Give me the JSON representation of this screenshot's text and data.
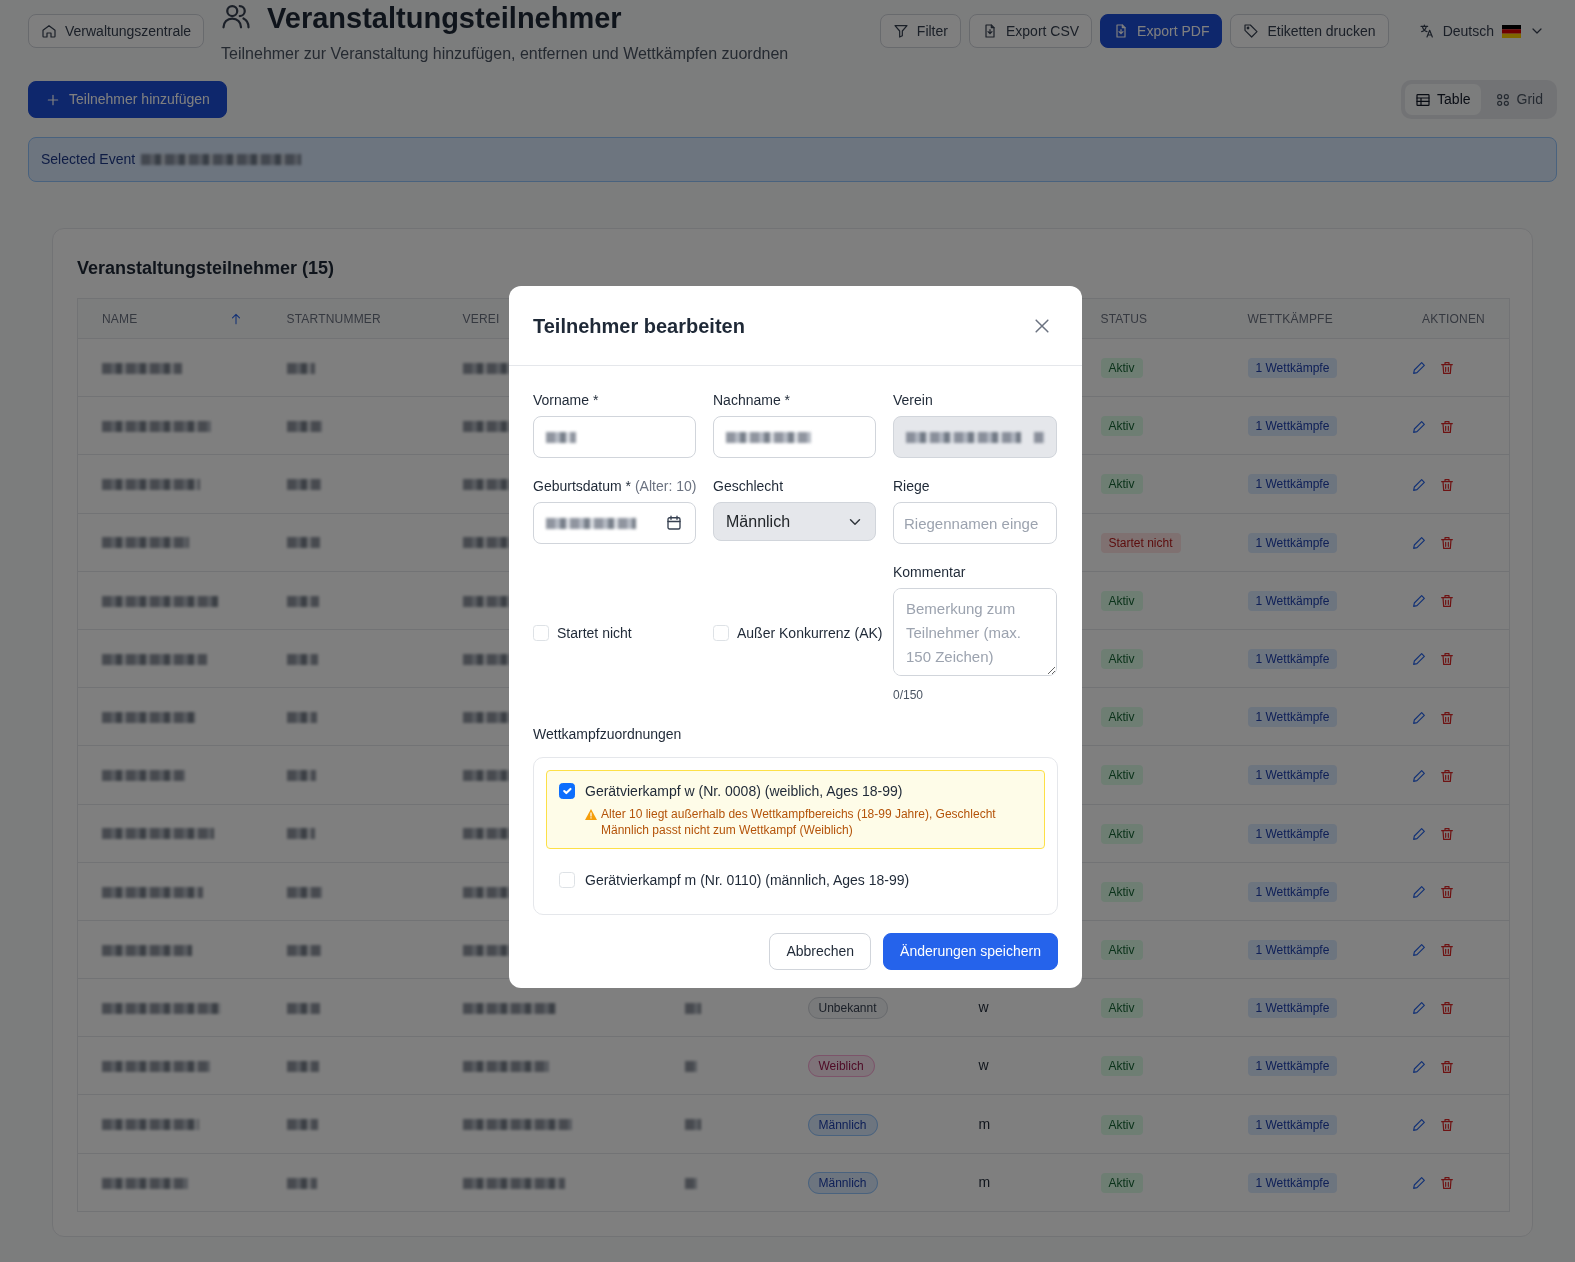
{
  "header": {
    "home_button": "Verwaltungszentrale",
    "title": "Veranstaltungsteilnehmer",
    "subtitle": "Teilnehmer zur Veranstaltung hinzufügen, entfernen und Wettkämpfen zuordnen",
    "actions": [
      {
        "label": "Filter",
        "kind": "filter",
        "primary": false
      },
      {
        "label": "Export CSV",
        "kind": "export",
        "primary": false
      },
      {
        "label": "Export PDF",
        "kind": "export",
        "primary": true
      },
      {
        "label": "Etiketten drucken",
        "kind": "labels",
        "primary": false
      }
    ],
    "language": "Deutsch"
  },
  "add_button": "Teilnehmer hinzufügen",
  "view_toggle": [
    {
      "label": "Table",
      "kind": "table",
      "selected": true
    },
    {
      "label": "Grid",
      "kind": "grid",
      "selected": false
    }
  ],
  "selected_event": {
    "label": "Selected Event"
  },
  "table": {
    "title": "Veranstaltungsteilnehmer (15)",
    "columns": [
      {
        "label": "NAME",
        "sorted": true
      },
      {
        "label": "STARTNUMMER",
        "sorted": false
      },
      {
        "label": "VEREI",
        "sorted": false
      },
      {
        "label": "STATUS",
        "sorted": false
      },
      {
        "label": "WETTKÄMPFE",
        "sorted": false
      },
      {
        "label": "AKTIONEN",
        "sorted": false
      }
    ],
    "rows": [
      {
        "status": {
          "label": "Aktiv",
          "kind": "active"
        },
        "competitions": "1 Wettkämpfe"
      },
      {
        "status": {
          "label": "Aktiv",
          "kind": "active"
        },
        "competitions": "1 Wettkämpfe"
      },
      {
        "status": {
          "label": "Aktiv",
          "kind": "active"
        },
        "competitions": "1 Wettkämpfe"
      },
      {
        "status": {
          "label": "Startet nicht",
          "kind": "not-starting"
        },
        "competitions": "1 Wettkämpfe"
      },
      {
        "status": {
          "label": "Aktiv",
          "kind": "active"
        },
        "competitions": "1 Wettkämpfe"
      },
      {
        "status": {
          "label": "Aktiv",
          "kind": "active"
        },
        "competitions": "1 Wettkämpfe"
      },
      {
        "status": {
          "label": "Aktiv",
          "kind": "active"
        },
        "competitions": "1 Wettkämpfe"
      },
      {
        "status": {
          "label": "Aktiv",
          "kind": "active"
        },
        "competitions": "1 Wettkämpfe"
      },
      {
        "status": {
          "label": "Aktiv",
          "kind": "active"
        },
        "competitions": "1 Wettkämpfe"
      },
      {
        "status": {
          "label": "Aktiv",
          "kind": "active"
        },
        "competitions": "1 Wettkämpfe"
      },
      {
        "status": {
          "label": "Aktiv",
          "kind": "active"
        },
        "competitions": "1 Wettkämpfe"
      },
      {
        "gender": {
          "label": "Unbekannt",
          "kind": "unknown"
        },
        "column_6": "w",
        "status": {
          "label": "Aktiv",
          "kind": "active"
        },
        "competitions": "1 Wettkämpfe"
      },
      {
        "gender": {
          "label": "Weiblich",
          "kind": "female"
        },
        "column_6": "w",
        "status": {
          "label": "Aktiv",
          "kind": "active"
        },
        "competitions": "1 Wettkämpfe"
      },
      {
        "gender": {
          "label": "Männlich",
          "kind": "male"
        },
        "column_6": "m",
        "status": {
          "label": "Aktiv",
          "kind": "active"
        },
        "competitions": "1 Wettkämpfe"
      },
      {
        "gender": {
          "label": "Männlich",
          "kind": "male"
        },
        "column_6": "m",
        "status": {
          "label": "Aktiv",
          "kind": "active"
        },
        "competitions": "1 Wettkämpfe"
      }
    ]
  },
  "modal": {
    "title": "Teilnehmer bearbeiten",
    "fields": [
      {
        "label": "Vorname *",
        "kind": "text"
      },
      {
        "label": "Nachname *",
        "kind": "text"
      },
      {
        "label": "Verein",
        "kind": "select-disabled"
      },
      {
        "label": "Geburtsdatum *",
        "hint": "(Alter: 10)",
        "kind": "date"
      },
      {
        "label": "Geschlecht",
        "kind": "select",
        "value": "Männlich"
      },
      {
        "label": "Riege",
        "kind": "text",
        "placeholder": "Riegennamen einge"
      }
    ],
    "checkboxes": [
      {
        "label": "Startet nicht",
        "checked": false
      },
      {
        "label": "Außer Konkurrenz (AK)",
        "checked": false
      }
    ],
    "comment": {
      "label": "Kommentar",
      "placeholder": "Bemerkung zum Teilnehmer (max. 150 Zeichen)",
      "counter": "0/150"
    },
    "assignments": {
      "label": "Wettkampfzuordnungen",
      "items": [
        {
          "label": "Gerätvierkampf w (Nr. 0008) (weiblich, Ages 18-99)",
          "checked": true,
          "warning": "Alter 10 liegt außerhalb des Wettkampfbereichs (18-99 Jahre), Geschlecht Männlich passt nicht zum Wettkampf (Weiblich)"
        },
        {
          "label": "Gerätvierkampf m (Nr. 0110) (männlich, Ages 18-99)",
          "checked": false
        }
      ]
    },
    "buttons": [
      {
        "label": "Abbrechen",
        "primary": false
      },
      {
        "label": "Änderungen speichern",
        "primary": true
      }
    ]
  }
}
